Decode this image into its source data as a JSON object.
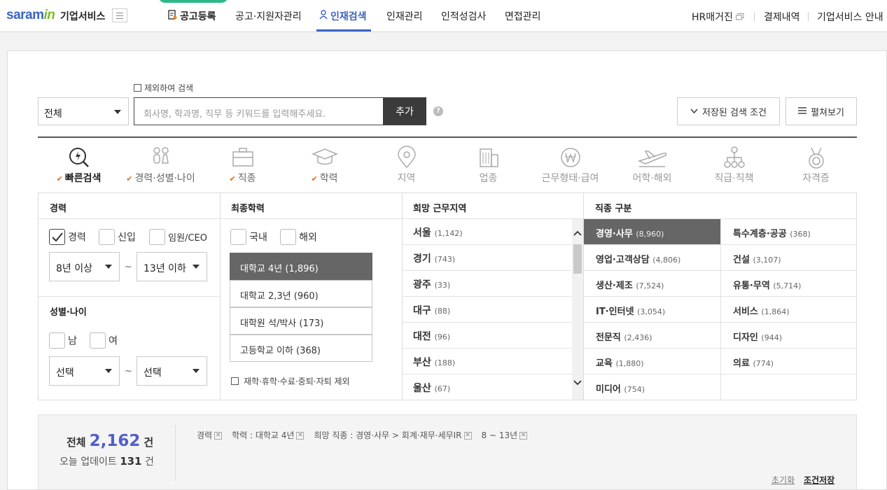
{
  "header": {
    "logo_main": "saram",
    "logo_accent": "in",
    "brand": "기업서비스",
    "nav": [
      "공고등록",
      "공고·지원자관리",
      "인재검색",
      "인재관리",
      "인적성검사",
      "면접관리"
    ],
    "right_links": [
      "HR매거진",
      "결제내역",
      "기업서비스 안내"
    ]
  },
  "search": {
    "exclude_label": "제외하여 검색",
    "scope_value": "전체",
    "keyword_placeholder": "회사명, 학과명, 직무 등 키워드를 입력해주세요.",
    "add_label": "추가",
    "help": "?",
    "saved_label": "저장된 검색 조건",
    "expand_label": "펼쳐보기"
  },
  "tabs": [
    {
      "label": "빠른검색",
      "icon": "lightning-search-icon",
      "checked": true
    },
    {
      "label": "경력·성별·나이",
      "icon": "people-icon",
      "checked": true
    },
    {
      "label": "직종",
      "icon": "briefcase-icon",
      "checked": true
    },
    {
      "label": "학력",
      "icon": "graduation-cap-icon",
      "checked": true
    },
    {
      "label": "지역",
      "icon": "location-pin-icon",
      "checked": false
    },
    {
      "label": "업종",
      "icon": "building-icon",
      "checked": false
    },
    {
      "label": "근무형태·급여",
      "icon": "won-coin-icon",
      "checked": false
    },
    {
      "label": "어학·해외",
      "icon": "airplane-icon",
      "checked": false
    },
    {
      "label": "직급·직책",
      "icon": "org-chart-icon",
      "checked": false
    },
    {
      "label": "자격증",
      "icon": "medal-icon",
      "checked": false
    }
  ],
  "career": {
    "title": "경력",
    "options": [
      "경력",
      "신입",
      "임원/CEO"
    ],
    "from": "8년 이상",
    "tilde": "~",
    "to": "13년 이하"
  },
  "gender_age": {
    "title": "성별·나이",
    "options": [
      "남",
      "여"
    ],
    "from": "선택",
    "tilde": "~",
    "to": "선택"
  },
  "education": {
    "title": "최종학력",
    "scope": [
      "국내",
      "해외"
    ],
    "items": [
      {
        "name": "대학교 4년",
        "count": "(1,896)"
      },
      {
        "name": "대학교 2,3년",
        "count": "(960)"
      },
      {
        "name": "대학원 석/박사",
        "count": "(173)"
      },
      {
        "name": "고등학교 이하",
        "count": "(368)"
      }
    ],
    "exclude_label": "재학·휴학·수료·중퇴·자퇴 제외"
  },
  "region": {
    "title": "희망 근무지역",
    "items": [
      {
        "name": "서울",
        "count": "(1,142)"
      },
      {
        "name": "경기",
        "count": "(743)"
      },
      {
        "name": "광주",
        "count": "(33)"
      },
      {
        "name": "대구",
        "count": "(88)"
      },
      {
        "name": "대전",
        "count": "(96)"
      },
      {
        "name": "부산",
        "count": "(188)"
      },
      {
        "name": "울산",
        "count": "(67)"
      }
    ]
  },
  "jobs": {
    "title": "직종 구분",
    "left": [
      {
        "name": "경영·사무",
        "count": "(8,960)"
      },
      {
        "name": "영업·고객상담",
        "count": "(4,806)"
      },
      {
        "name": "생산·제조",
        "count": "(7,524)"
      },
      {
        "name": "IT·인터넷",
        "count": "(3,054)"
      },
      {
        "name": "전문직",
        "count": "(2,436)"
      },
      {
        "name": "교육",
        "count": "(1,880)"
      },
      {
        "name": "미디어",
        "count": "(754)"
      }
    ],
    "right": [
      {
        "name": "특수계층·공공",
        "count": "(368)"
      },
      {
        "name": "건설",
        "count": "(3,107)"
      },
      {
        "name": "유통·무역",
        "count": "(5,714)"
      },
      {
        "name": "서비스",
        "count": "(1,864)"
      },
      {
        "name": "디자인",
        "count": "(944)"
      },
      {
        "name": "의료",
        "count": "(774)"
      }
    ]
  },
  "summary": {
    "total_label": "전체",
    "total_count": "2,162",
    "unit": "건",
    "today_label": "오늘 업데이트",
    "today_count": "131",
    "today_unit": "건",
    "conditions": [
      "경력",
      "학력 : 대학교 4년",
      "희망 직종 : 경영·사무 > 회계·재무·세무IR",
      "8 ~ 13년"
    ],
    "reset_label": "초기화",
    "save_label": "조건저장"
  }
}
